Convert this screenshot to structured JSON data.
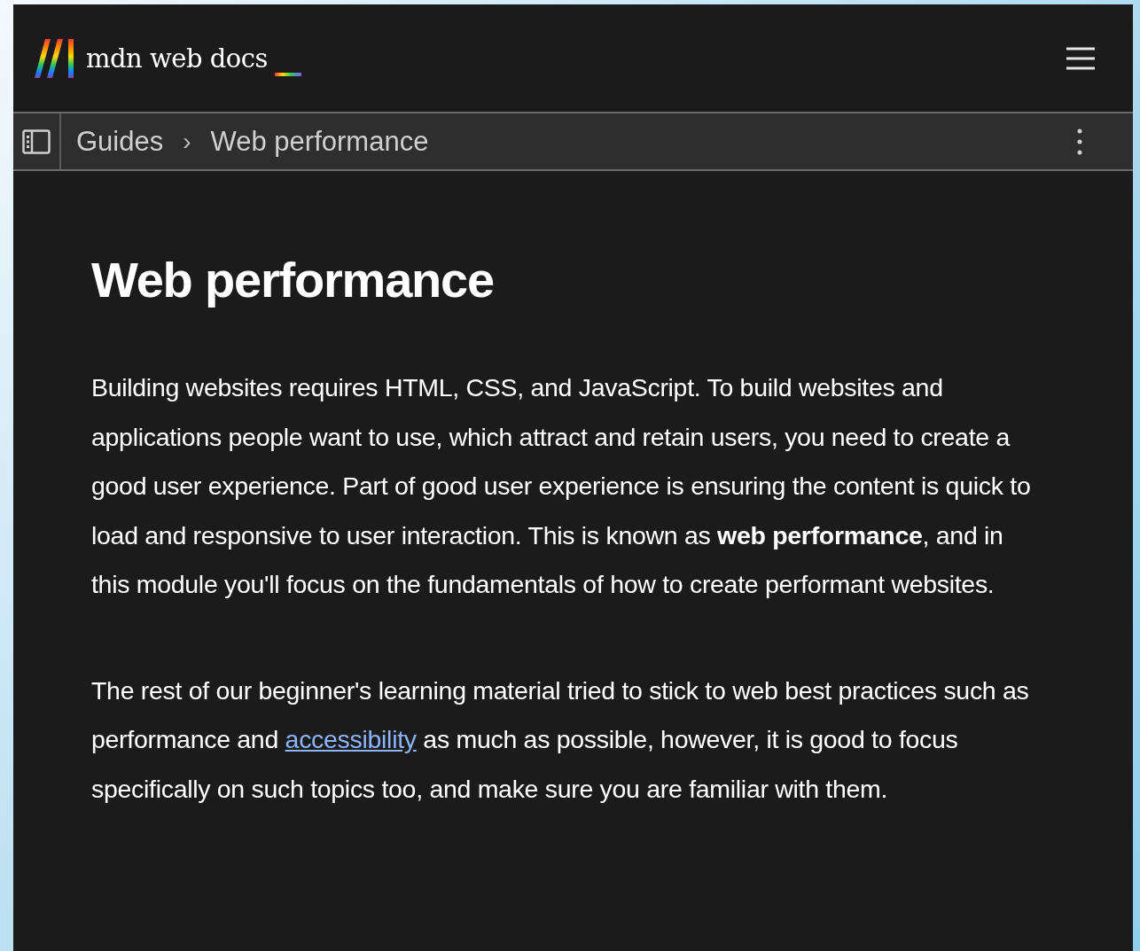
{
  "header": {
    "logo_text": "mdn web docs"
  },
  "breadcrumbs": [
    {
      "label": "Guides"
    },
    {
      "label": "Web performance"
    }
  ],
  "breadcrumb_separator": "›",
  "article": {
    "title": "Web performance",
    "paragraphs": [
      {
        "text": "Building websites requires HTML, CSS, and JavaScript. To build websites and applications people want to use, which attract and retain users, you need to create a good user experience. Part of good user experience is ensuring the content is quick to load and responsive to user interaction. This is known as **web performance**, and in this module you'll focus on the fundamentals of how to create performant websites."
      },
      {
        "text": "The rest of our beginner's learning material tried to stick to web best practices such as performance and ",
        "link": "accessibility",
        "after": " as much as possible, however, it is good to focus specifically on such topics too, and make sure you are familiar with them."
      }
    ]
  }
}
